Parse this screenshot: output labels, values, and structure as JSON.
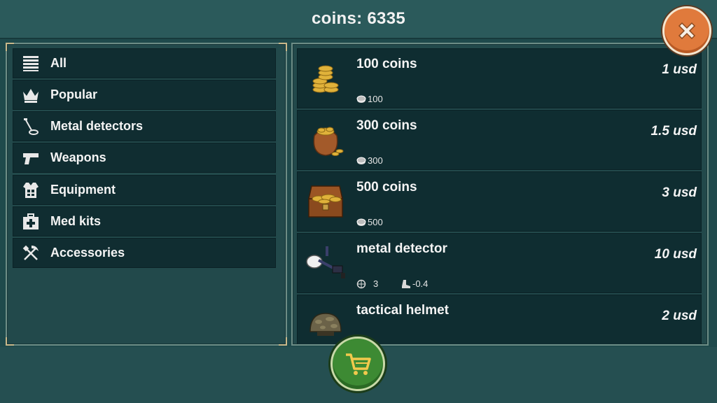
{
  "header": {
    "coins_text": "coins: 6335"
  },
  "categories": [
    {
      "label": "All",
      "icon": "list-icon"
    },
    {
      "label": "Popular",
      "icon": "crown-icon"
    },
    {
      "label": "Metal detectors",
      "icon": "metal-detector-icon"
    },
    {
      "label": "Weapons",
      "icon": "pistol-icon"
    },
    {
      "label": "Equipment",
      "icon": "vest-icon"
    },
    {
      "label": "Med kits",
      "icon": "medkit-icon"
    },
    {
      "label": "Accessories",
      "icon": "pick-shovel-icon"
    }
  ],
  "items": [
    {
      "name": "100 coins",
      "price": "1 usd",
      "stat": "100",
      "icon": "coin-stack-icon"
    },
    {
      "name": "300 coins",
      "price": "1.5 usd",
      "stat": "300",
      "icon": "coin-bag-icon"
    },
    {
      "name": "500 coins",
      "price": "3 usd",
      "stat": "500",
      "icon": "treasure-chest-icon"
    },
    {
      "name": "metal detector",
      "price": "10 usd",
      "stat1": "3",
      "stat2": "-0.4",
      "icon": "metal-detector-icon"
    },
    {
      "name": "tactical helmet",
      "price": "2 usd",
      "icon": "helmet-icon"
    }
  ],
  "colors": {
    "accent_close": "#e07a3c",
    "accent_cart": "#3d8a33",
    "panel": "#22494b",
    "row": "#0f2d31"
  }
}
